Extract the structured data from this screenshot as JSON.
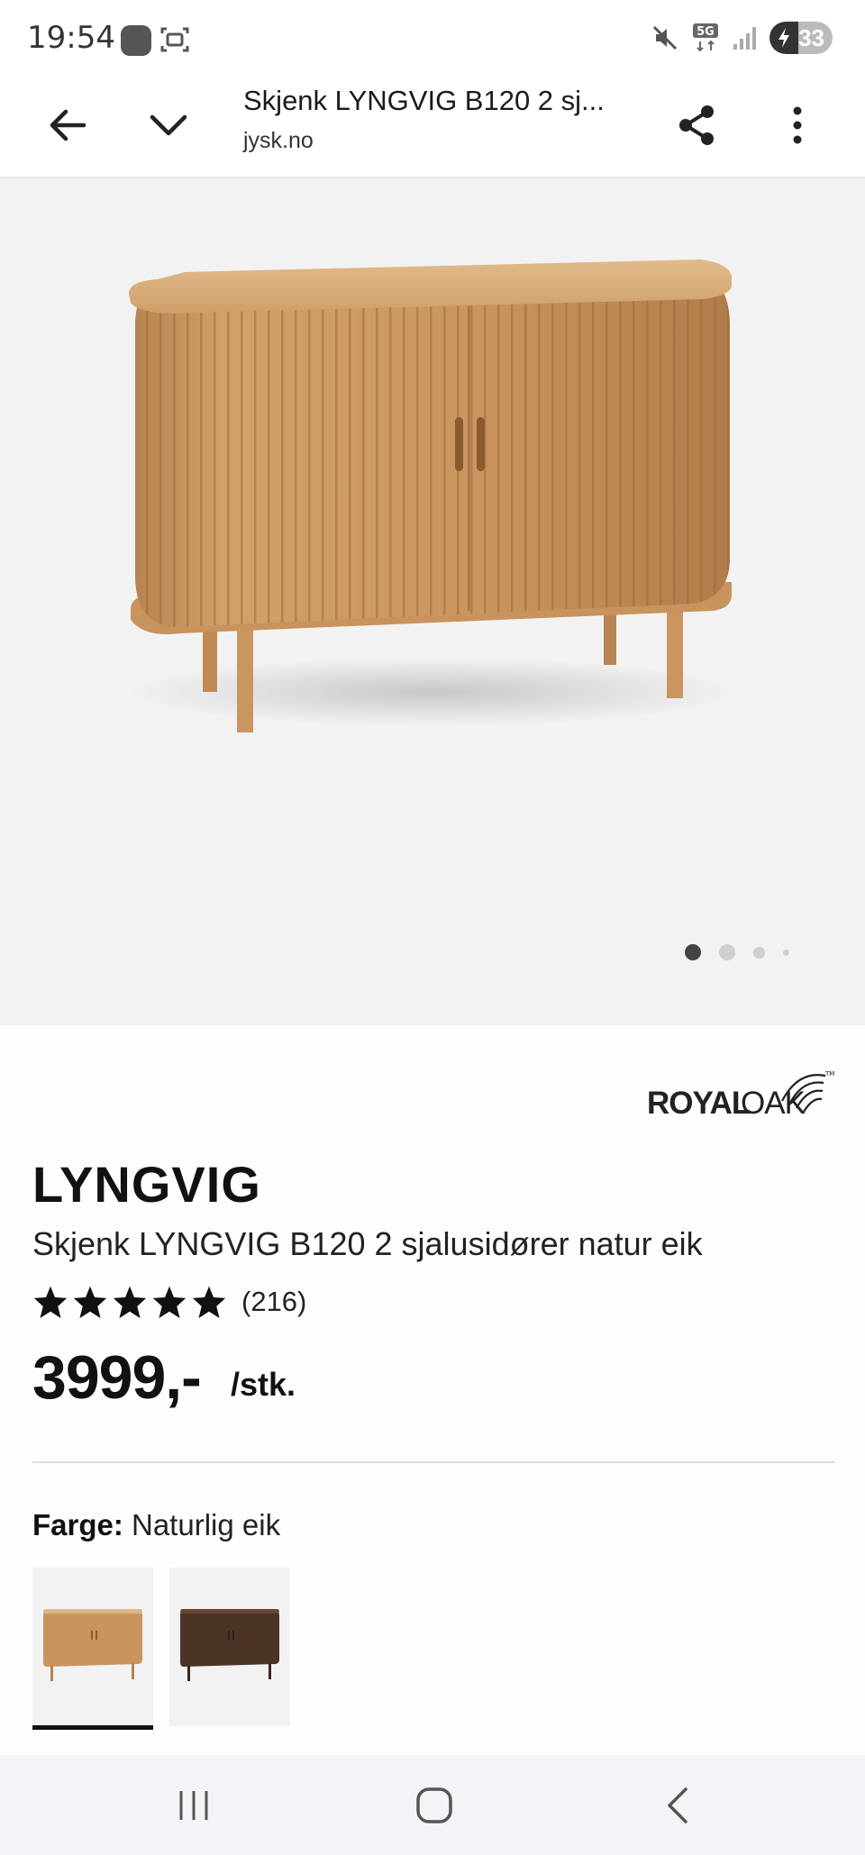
{
  "status_bar": {
    "time": "19:54",
    "network": "5G",
    "battery": "33"
  },
  "browser": {
    "page_title": "Skjenk LYNGVIG B120 2 sj...",
    "domain": "jysk.no"
  },
  "hero": {
    "image_count": 4,
    "active_index": 0
  },
  "brand": {
    "name": "ROYALOAK"
  },
  "product": {
    "name": "LYNGVIG",
    "description": "Skjenk LYNGVIG B120 2 sjalusidører natur eik",
    "rating_stars": 5,
    "rating_count": "(216)",
    "price": "3999,-",
    "price_unit": "/stk."
  },
  "color": {
    "label": "Farge:",
    "value": "Naturlig eik",
    "swatches": [
      {
        "name": "natur eik",
        "hex": "#c9955e",
        "selected": true
      },
      {
        "name": "mørk eik",
        "hex": "#4b3426",
        "selected": false
      }
    ]
  },
  "colors": {
    "wood": "#c9955e",
    "hero_bg": "#f2f2f2"
  }
}
